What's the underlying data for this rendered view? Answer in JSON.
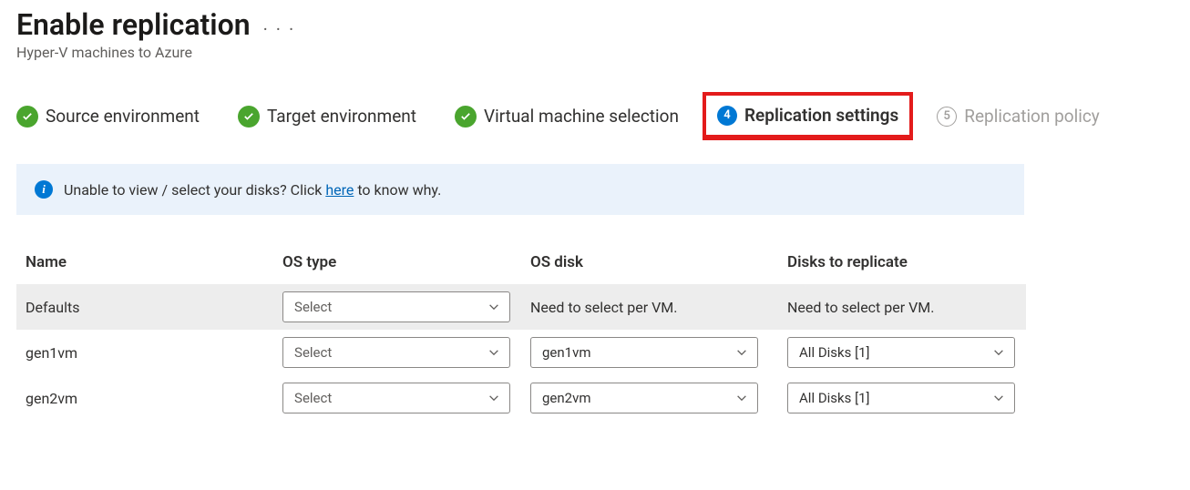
{
  "header": {
    "title": "Enable replication",
    "subtitle": "Hyper-V machines to Azure"
  },
  "steps": {
    "s1": {
      "label": "Source environment"
    },
    "s2": {
      "label": "Target environment"
    },
    "s3": {
      "label": "Virtual machine selection"
    },
    "s4": {
      "num": "4",
      "label": "Replication settings"
    },
    "s5": {
      "num": "5",
      "label": "Replication policy"
    }
  },
  "banner": {
    "text_before": "Unable to view / select your disks? Click ",
    "link": "here",
    "text_after": " to know why."
  },
  "table": {
    "headers": {
      "name": "Name",
      "os_type": "OS type",
      "os_disk": "OS disk",
      "disks": "Disks to replicate"
    },
    "defaults": {
      "name": "Defaults",
      "os_type_value": "Select",
      "os_disk_text": "Need to select per VM.",
      "disks_text": "Need to select per VM."
    },
    "rows": [
      {
        "name": "gen1vm",
        "os_type_value": "Select",
        "os_disk_value": "gen1vm",
        "disks_value": "All Disks [1]"
      },
      {
        "name": "gen2vm",
        "os_type_value": "Select",
        "os_disk_value": "gen2vm",
        "disks_value": "All Disks [1]"
      }
    ]
  }
}
